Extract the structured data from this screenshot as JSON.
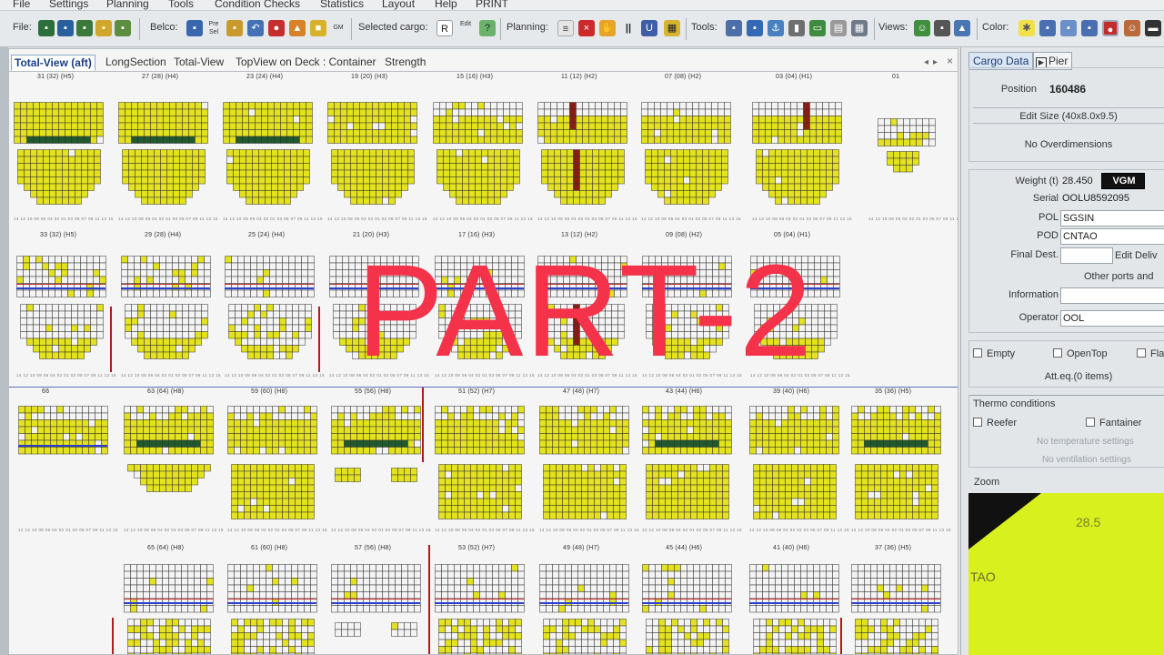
{
  "menu": [
    "File",
    "Settings",
    "Planning",
    "Tools",
    "Condition Checks",
    "Statistics",
    "Layout",
    "Help",
    "PRINT"
  ],
  "toolbar": {
    "groups": [
      "File:",
      "Belco:",
      "Selected cargo:",
      "Planning:",
      "Tools:",
      "Views:",
      "Color:"
    ],
    "tiny_labels": {
      "pre_sel": "Pre Sel",
      "gm": "GM",
      "edit": "Edit"
    }
  },
  "tabs": [
    "Total-View (aft)",
    "LongSection",
    "Total-View",
    "TopView on Deck : Container",
    "Strength"
  ],
  "bay_rows": [
    [
      "31 (32) (H5)",
      "27 (28) (H4)",
      "23 (24) (H4)",
      "19 (20) (H3)",
      "15 (16) (H3)",
      "11 (12) (H2)",
      "07 (08) (H2)",
      "03 (04) (H1)",
      "01"
    ],
    [
      "33 (32) (H5)",
      "29 (28) (H4)",
      "25 (24) (H4)",
      "21 (20) (H3)",
      "17 (16) (H3)",
      "13 (12) (H2)",
      "09 (08) (H2)",
      "05 (04) (H1)"
    ],
    [
      "66",
      "63 (64) (H8)",
      "59 (60) (H8)",
      "55 (56) (H8)",
      "51 (52) (H7)",
      "47 (48) (H7)",
      "43 (44) (H6)",
      "39 (40) (H6)",
      "35 (36) (H5)"
    ],
    [
      "65 (64) (H8)",
      "61 (60) (H8)",
      "57 (56) (H8)",
      "53 (52) (H7)",
      "49 (48) (H7)",
      "45 (44) (H6)",
      "41 (40) (H6)",
      "37 (36) (H5)"
    ]
  ],
  "row_numbers": "14 12 10 08 06 04 02 01 03 05 07 09 11 13 15",
  "cargo": {
    "tabs": [
      "Cargo Data",
      "Pier"
    ],
    "position_label": "Position",
    "position": "160486",
    "edit_size": "Edit Size (40x8.0x9.5)",
    "overdim": "No Overdimensions",
    "weight_label": "Weight (t)",
    "weight": "28.450",
    "vgm": "VGM",
    "serial_label": "Serial",
    "serial": "OOLU8592095",
    "pol_label": "POL",
    "pol": "SGSIN",
    "pod_label": "POD",
    "pod": "CNTAO",
    "final_label": "Final Dest.",
    "final": "",
    "edit_deliv": "Edit Deliv",
    "other_ports": "Other ports and",
    "info_label": "Information",
    "info": "",
    "operator_label": "Operator",
    "operator": "OOL",
    "empty": "Empty",
    "opentop": "OpenTop",
    "flat": "Fla",
    "att_eq": "Att.eq.(0 items)",
    "thermo": "Thermo conditions",
    "reefer": "Reefer",
    "fantainer": "Fantainer",
    "no_temp": "No temperature settings",
    "no_vent": "No ventilation settings",
    "zoom": "Zoom",
    "zoom_weight": "28.5",
    "zoom_pod": "TAO"
  },
  "overlay_text": "PART-2",
  "colors": {
    "loaded": "#e4e11e",
    "empty_cell": "#f3f3f3",
    "grid": "#333333",
    "reefer": "#1f5a2e",
    "hazard": "#8c1b13",
    "band": "#2b3fd0",
    "overlay": "#f4324a"
  }
}
